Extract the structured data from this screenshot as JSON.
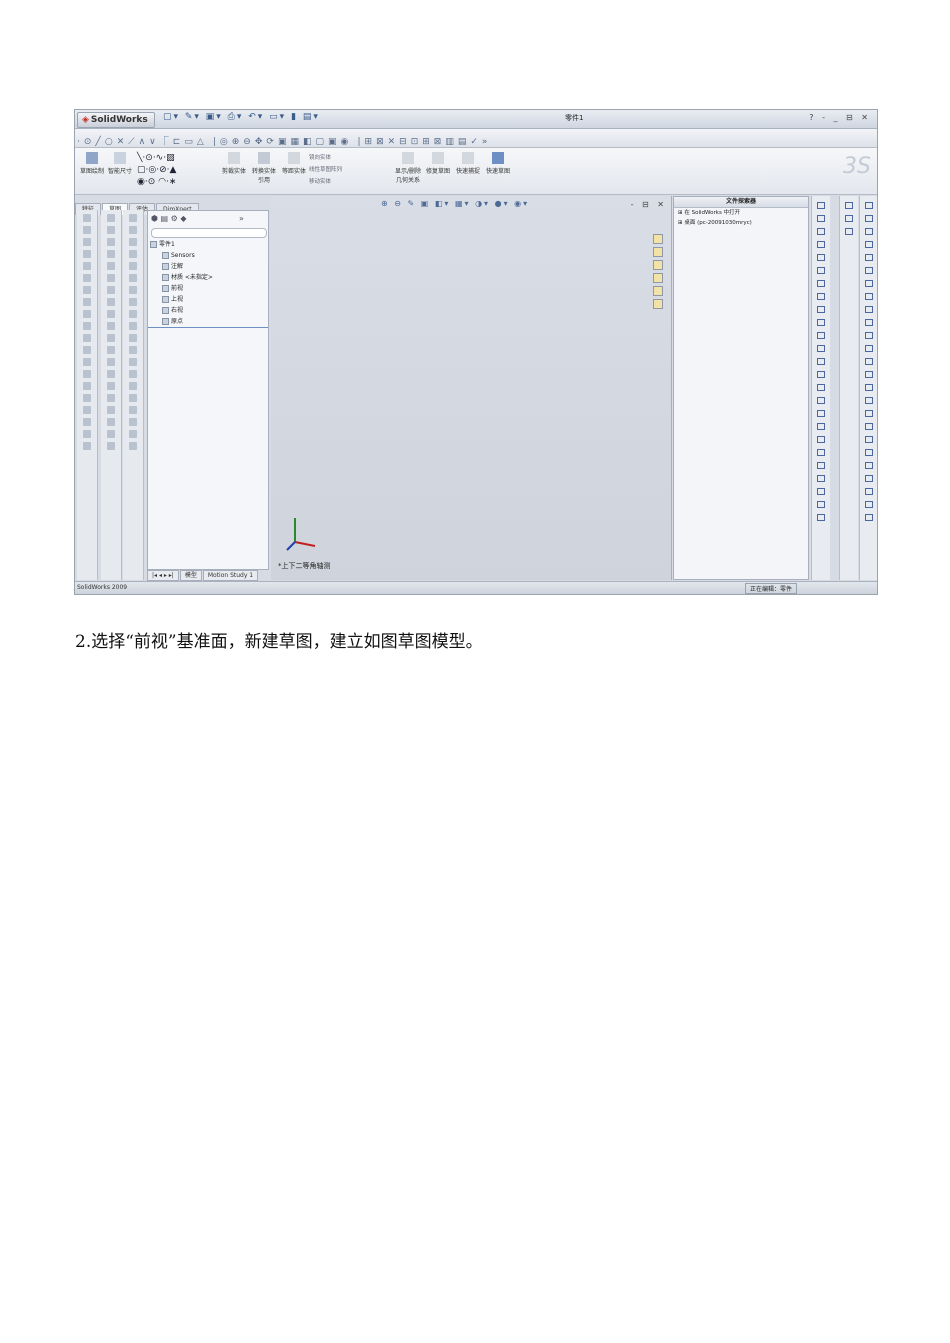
{
  "app": {
    "logo": "SolidWorks",
    "title": "零件1",
    "window_controls": "? - _ ⊟ ✕"
  },
  "tabs": [
    "特征",
    "草图",
    "评估",
    "DimXpert"
  ],
  "command_manager": [
    {
      "label": "草图绘制"
    },
    {
      "label": "智能尺寸"
    },
    {
      "label": "剪裁实体"
    },
    {
      "label": "转换实体引用"
    },
    {
      "label": "等距实体"
    },
    {
      "label": "镜向实体"
    },
    {
      "label": "线性草图阵列"
    },
    {
      "label": "移动实体"
    },
    {
      "label": "显示/删除几何关系"
    },
    {
      "label": "修复草图"
    },
    {
      "label": "快速捕捉"
    },
    {
      "label": "快速草图"
    }
  ],
  "feature_tree": {
    "root": "零件1",
    "items": [
      "Sensors",
      "注解",
      "材质 <未指定>",
      "前视",
      "上视",
      "右视",
      "原点"
    ]
  },
  "bottom_tabs": [
    "模型",
    "Motion Study 1"
  ],
  "viewport": {
    "view_label": "*上下二等角轴测",
    "window_controls": "- ⊟ ✕"
  },
  "task_pane": {
    "title": "文件探索器",
    "items": [
      "在 SolidWorks 中打开",
      "桌面 (pc-20091030mryc)"
    ]
  },
  "status": {
    "left": "SolidWorks 2009",
    "right": "正在编辑：零件"
  },
  "caption": "2.选择“前视”基准面，新建草图，建立如图草图模型。"
}
